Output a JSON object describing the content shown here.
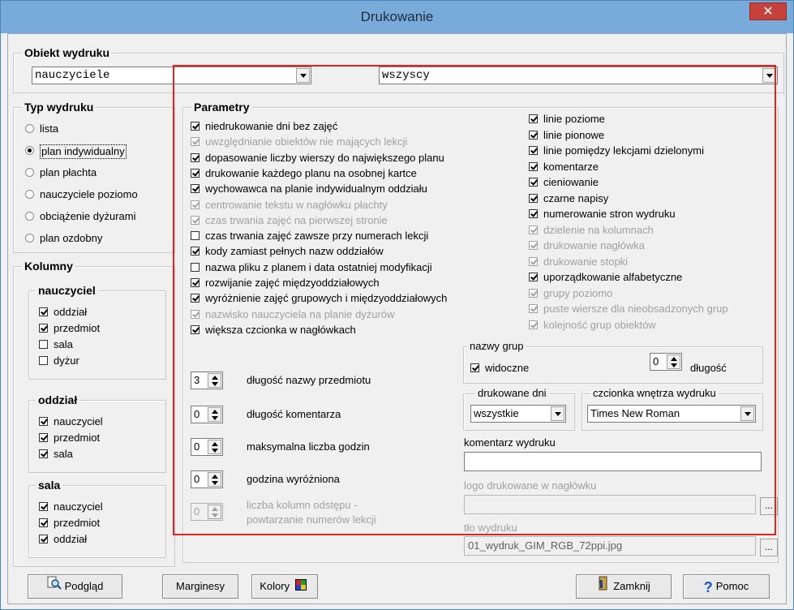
{
  "window": {
    "title": "Drukowanie",
    "close": "✕"
  },
  "obiekt": {
    "legend": "Obiekt wydruku",
    "object_value": "nauczyciele",
    "filter_value": "wszyscy"
  },
  "typ": {
    "legend": "Typ wydruku",
    "options": [
      "lista",
      "plan indywidualny",
      "plan płachta",
      "nauczyciele poziomo",
      "obciążenie dyżurami",
      "plan ozdobny"
    ],
    "selected": "plan indywidualny"
  },
  "kolumny": {
    "legend": "Kolumny",
    "nauczyciel": {
      "legend": "nauczyciel",
      "items": [
        {
          "label": "oddział",
          "checked": true
        },
        {
          "label": "przedmiot",
          "checked": true
        },
        {
          "label": "sala",
          "checked": false
        },
        {
          "label": "dyżur",
          "checked": false
        }
      ]
    },
    "oddzial": {
      "legend": "oddział",
      "items": [
        {
          "label": "nauczyciel",
          "checked": true
        },
        {
          "label": "przedmiot",
          "checked": true
        },
        {
          "label": "sala",
          "checked": true
        }
      ]
    },
    "sala": {
      "legend": "sala",
      "items": [
        {
          "label": "nauczyciel",
          "checked": true
        },
        {
          "label": "przedmiot",
          "checked": true
        },
        {
          "label": "oddział",
          "checked": true
        }
      ]
    }
  },
  "parametry": {
    "legend": "Parametry",
    "left": [
      {
        "label": "niedrukowanie dni bez zajęć",
        "checked": true,
        "disabled": false
      },
      {
        "label": "uwzględnianie obiektów nie mających lekcji",
        "checked": true,
        "disabled": true
      },
      {
        "label": "dopasowanie liczby wierszy do największego planu",
        "checked": true,
        "disabled": false
      },
      {
        "label": "drukowanie każdego planu na osobnej kartce",
        "checked": true,
        "disabled": false
      },
      {
        "label": "wychowawca na planie indywidualnym oddziału",
        "checked": true,
        "disabled": false
      },
      {
        "label": "centrowanie tekstu w nagłówku płachty",
        "checked": true,
        "disabled": true
      },
      {
        "label": "czas trwania zajęć na pierwszej stronie",
        "checked": true,
        "disabled": true
      },
      {
        "label": "czas trwania zajęć zawsze przy numerach lekcji",
        "checked": false,
        "disabled": false
      },
      {
        "label": "kody zamiast pełnych nazw oddziałów",
        "checked": true,
        "disabled": false
      },
      {
        "label": "nazwa pliku z planem i data ostatniej modyfikacji",
        "checked": false,
        "disabled": false
      },
      {
        "label": "rozwijanie zajęć międzyoddziałowych",
        "checked": true,
        "disabled": false
      },
      {
        "label": "wyróżnienie zajęć grupowych i międzyoddziałowych",
        "checked": true,
        "disabled": false
      },
      {
        "label": "nazwisko nauczyciela na planie dyżurów",
        "checked": true,
        "disabled": true
      },
      {
        "label": "większa czcionka w nagłówkach",
        "checked": true,
        "disabled": false
      }
    ],
    "right": [
      {
        "label": "linie poziome",
        "checked": true,
        "disabled": false
      },
      {
        "label": "linie pionowe",
        "checked": true,
        "disabled": false
      },
      {
        "label": "linie pomiędzy lekcjami dzielonymi",
        "checked": true,
        "disabled": false
      },
      {
        "label": "komentarze",
        "checked": true,
        "disabled": false
      },
      {
        "label": "cieniowanie",
        "checked": true,
        "disabled": false
      },
      {
        "label": "czarne napisy",
        "checked": true,
        "disabled": false
      },
      {
        "label": "numerowanie stron wydruku",
        "checked": true,
        "disabled": false
      },
      {
        "label": "dzielenie na kolumnach",
        "checked": true,
        "disabled": true
      },
      {
        "label": "drukowanie nagłówka",
        "checked": true,
        "disabled": true
      },
      {
        "label": "drukowanie stopki",
        "checked": true,
        "disabled": true
      },
      {
        "label": "uporządkowanie alfabetyczne",
        "checked": true,
        "disabled": false
      },
      {
        "label": "grupy poziomo",
        "checked": true,
        "disabled": true
      },
      {
        "label": "puste wiersze dla nieobsadzonych grup",
        "checked": true,
        "disabled": true
      },
      {
        "label": "kolejność grup obiektów",
        "checked": true,
        "disabled": true
      }
    ],
    "spinners": [
      {
        "value": "3",
        "label": "długość nazwy przedmiotu",
        "disabled": false
      },
      {
        "value": "0",
        "label": "długość komentarza",
        "disabled": false
      },
      {
        "value": "0",
        "label": "maksymalna liczba godzin",
        "disabled": false
      },
      {
        "value": "0",
        "label": "godzina wyróżniona",
        "disabled": false
      },
      {
        "value": "0",
        "label": "liczba kolumn odstępu -",
        "label2": "powtarzanie numerów lekcji",
        "disabled": true
      }
    ],
    "nazwy_grup": {
      "legend": "nazwy grup",
      "widoczne": "widoczne",
      "widoczne_checked": true,
      "dlugosc_value": "0",
      "dlugosc_label": "długość"
    },
    "drukowane_dni": {
      "legend": "drukowane dni",
      "value": "wszystkie"
    },
    "czcionka": {
      "legend": "czcionka wnętrza wydruku",
      "value": "Times New Roman"
    },
    "komentarz": {
      "label": "komentarz wydruku",
      "value": ""
    },
    "logo": {
      "label": "logo drukowane w nagłówku",
      "value": "",
      "browse": "..."
    },
    "tlo": {
      "label": "tło wydruku",
      "value": "01_wydruk_GIM_RGB_72ppi.jpg",
      "browse": "..."
    }
  },
  "buttons": {
    "podglad": "Podgląd",
    "marginesy": "Marginesy",
    "kolory": "Kolory",
    "zamknij": "Zamknij",
    "pomoc": "Pomoc"
  }
}
